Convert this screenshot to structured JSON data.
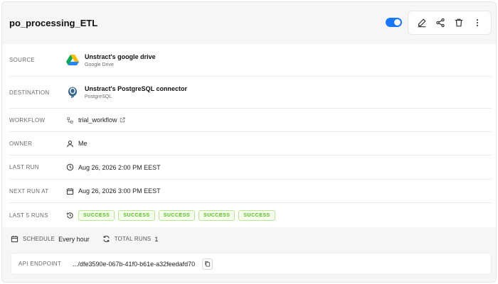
{
  "pipeline": {
    "title": "po_processing_ETL",
    "enabled": true
  },
  "toolbar": {
    "icons": [
      "edit-icon",
      "share-icon",
      "delete-icon",
      "more-vertical-icon"
    ]
  },
  "rows": {
    "source": {
      "label": "SOURCE",
      "name": "Unstract's google drive",
      "type": "Google Drive",
      "icon": "google-drive-icon"
    },
    "destination": {
      "label": "DESTINATION",
      "name": "Unstract's PostgreSQL connector",
      "type": "PostgreSQL",
      "icon": "postgresql-icon"
    },
    "workflow": {
      "label": "WORKFLOW",
      "value": "trial_workflow",
      "icon": "workflow-icon"
    },
    "owner": {
      "label": "OWNER",
      "value": "Me",
      "icon": "user-icon"
    },
    "last_run": {
      "label": "LAST RUN",
      "value": "Aug 26, 2026 2:00 PM EEST",
      "icon": "clock-icon"
    },
    "next_run": {
      "label": "NEXT RUN AT",
      "value": "Aug 26, 2026 3:00 PM EEST",
      "icon": "calendar-icon"
    },
    "last_5_runs": {
      "label": "LAST 5 RUNS",
      "icon": "history-icon",
      "statuses": [
        "SUCCESS",
        "SUCCESS",
        "SUCCESS",
        "SUCCESS",
        "SUCCESS"
      ]
    }
  },
  "stats": {
    "schedule_label": "SCHEDULE",
    "schedule_value": "Every hour",
    "total_runs_label": "TOTAL RUNS",
    "total_runs_value": "1"
  },
  "api": {
    "label": "API ENDPOINT",
    "value": ".../dfe3590e-067b-41f0-b61e-a32feedafd70"
  },
  "colors": {
    "accent": "#1677ff",
    "success_text": "#52c41a",
    "success_bg": "#f6ffed",
    "success_border": "#b7eb8f"
  }
}
